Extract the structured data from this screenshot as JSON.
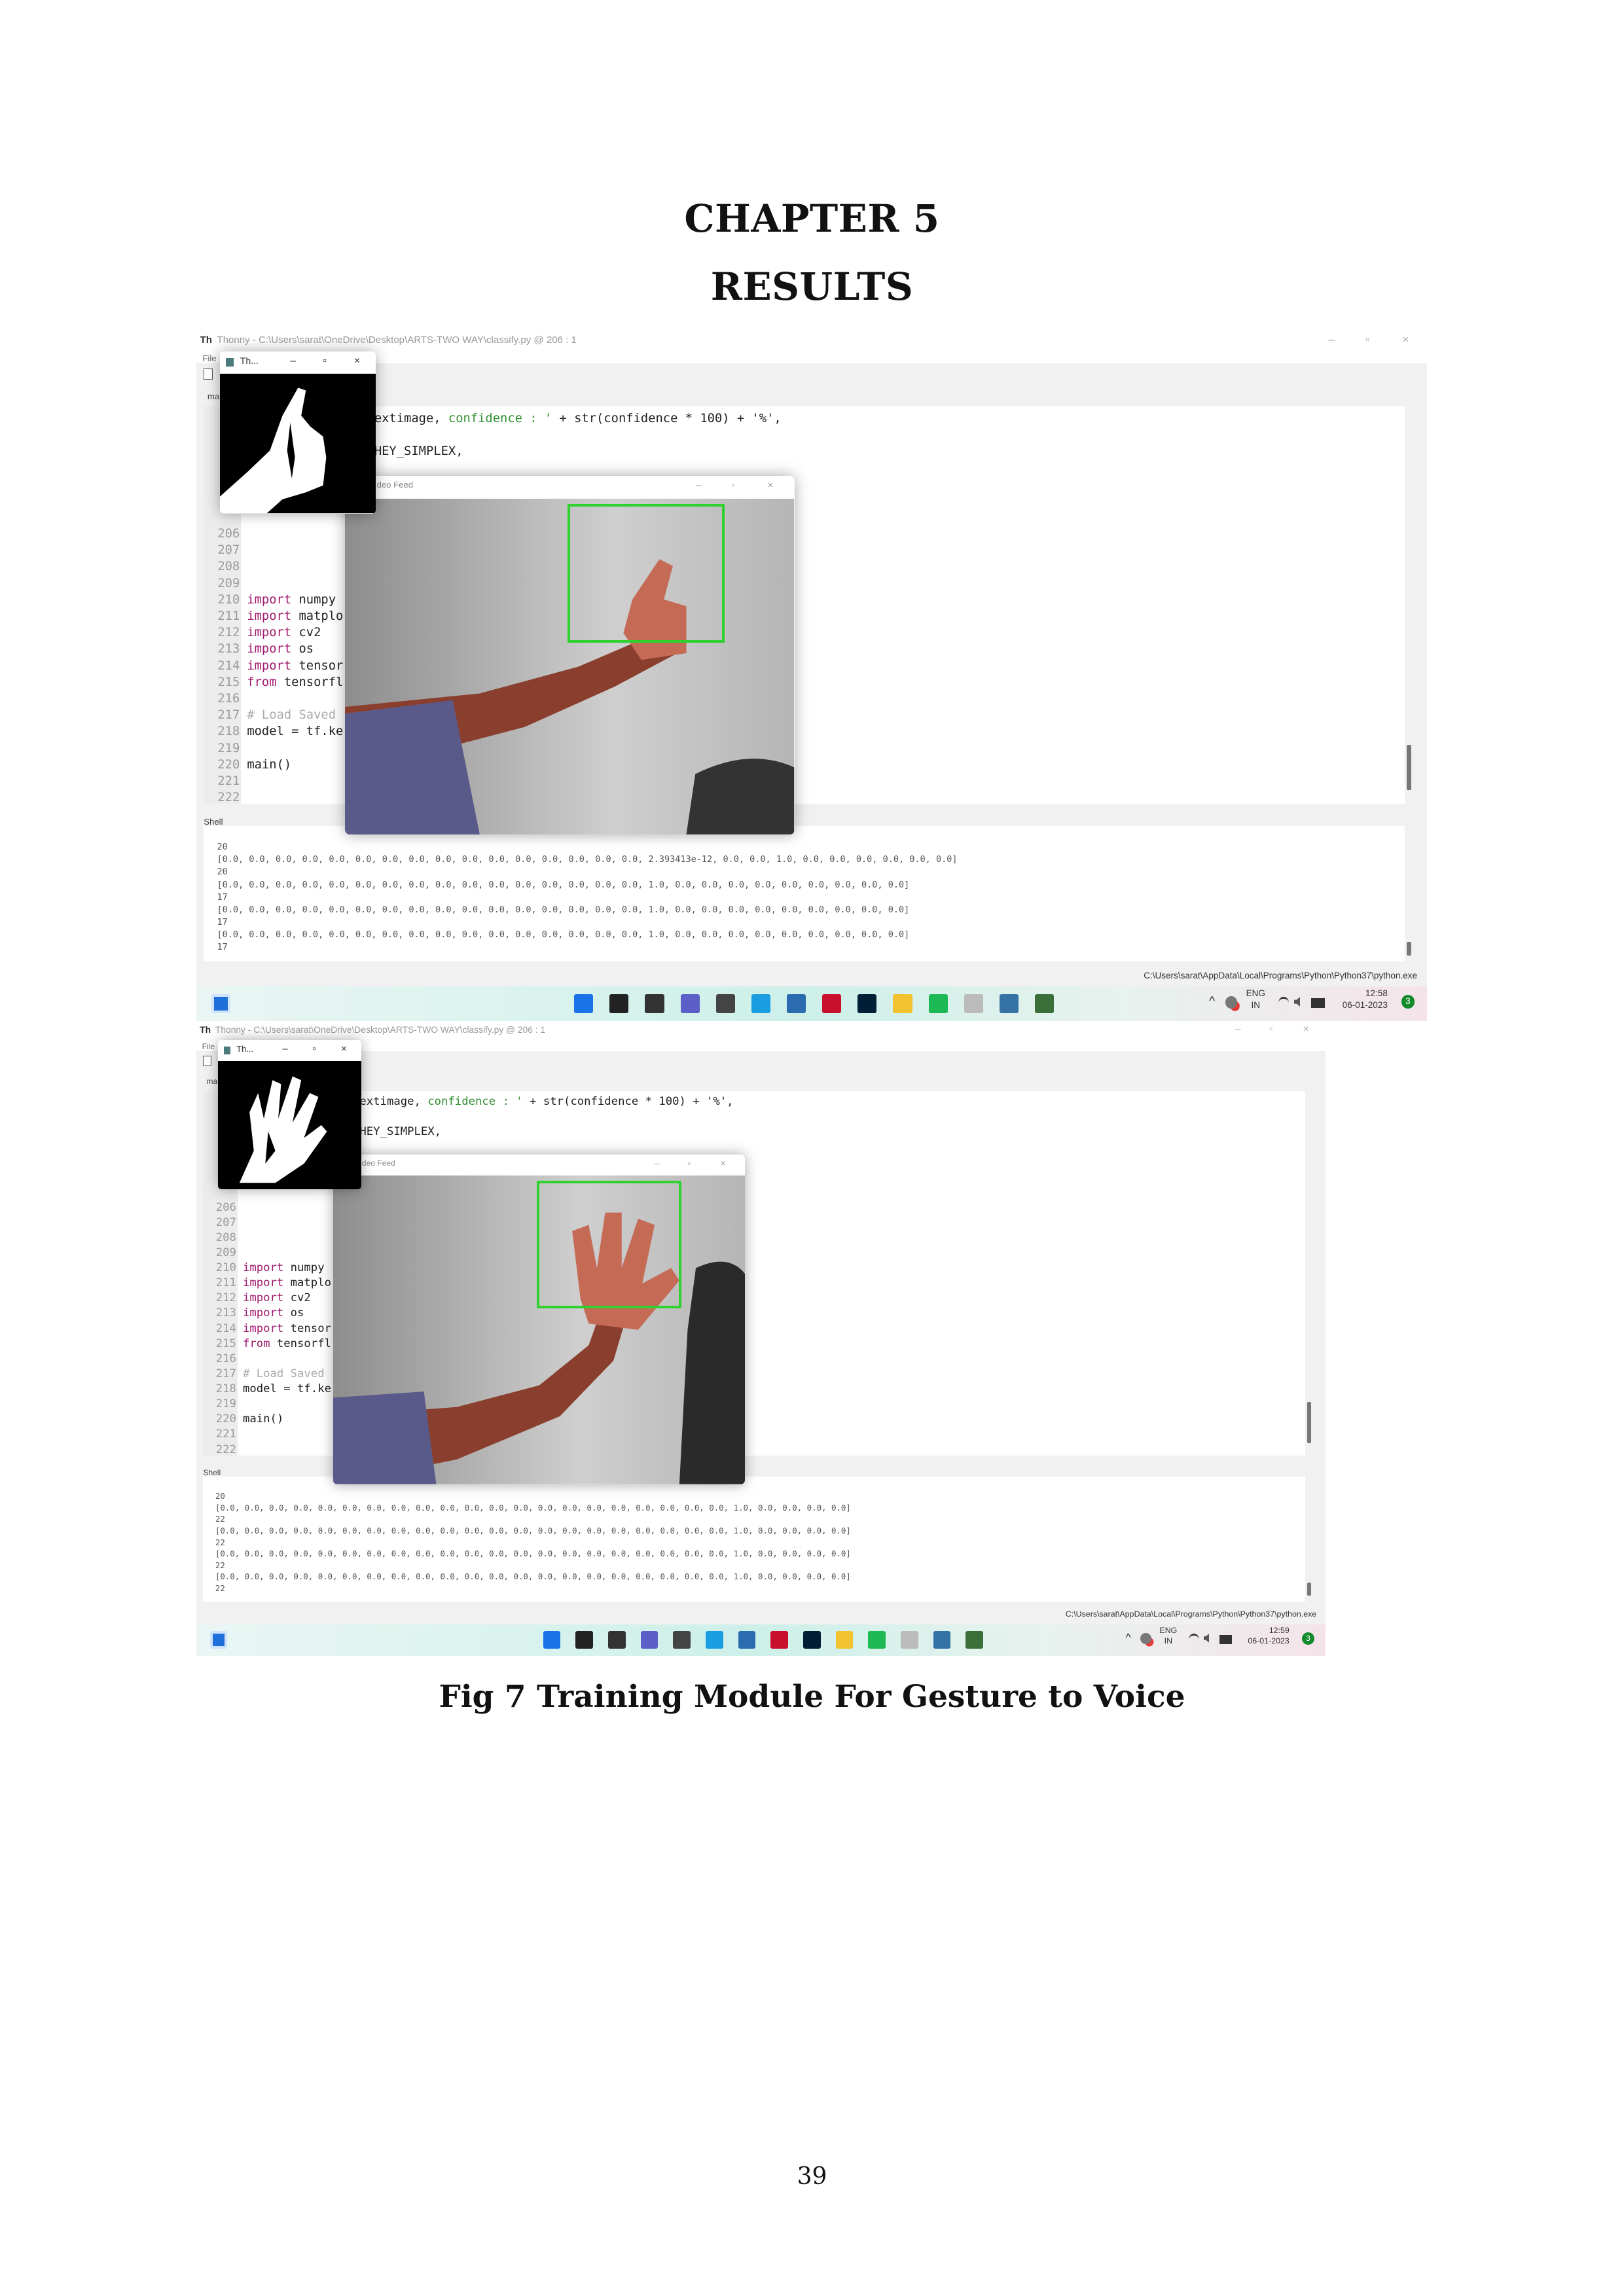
{
  "page": {
    "chapter": "CHAPTER 5",
    "title": "RESULTS",
    "caption": "Fig 7 Training Module For Gesture to Voice",
    "page_number": "39"
  },
  "screenshots": [
    {
      "app_name": "Thonny",
      "window_title": "Thonny - C:\\Users\\sarat\\OneDrive\\Desktop\\ARTS-TWO WAY\\classify.py @ 206 : 1",
      "menu_file": "File",
      "editor_tab": "ma",
      "threshold_window_title": "Th...",
      "video_window_title": "deo Feed",
      "code_fragment_1a": "extimage, ",
      "code_fragment_1b": "confidence : '",
      "code_fragment_1c": " + str(confidence * 100) + '%',",
      "code_fragment_2": "HEY_SIMPLEX,",
      "lines": [
        {
          "n": "206",
          "kw": "",
          "rest": ""
        },
        {
          "n": "207",
          "kw": "",
          "rest": ""
        },
        {
          "n": "208",
          "kw": "",
          "rest": ""
        },
        {
          "n": "209",
          "kw": "",
          "rest": ""
        },
        {
          "n": "210",
          "kw": "import",
          "rest": " numpy"
        },
        {
          "n": "211",
          "kw": "import",
          "rest": " matplo"
        },
        {
          "n": "212",
          "kw": "import",
          "rest": " cv2"
        },
        {
          "n": "213",
          "kw": "import",
          "rest": " os"
        },
        {
          "n": "214",
          "kw": "import",
          "rest": " tensor"
        },
        {
          "n": "215",
          "kw": "from",
          "rest": " tensorfl"
        },
        {
          "n": "216",
          "kw": "",
          "rest": ""
        },
        {
          "n": "217",
          "kw": "",
          "rest": "",
          "comment": "# Load Saved"
        },
        {
          "n": "218",
          "kw": "",
          "rest": "model = tf.ke"
        },
        {
          "n": "219",
          "kw": "",
          "rest": ""
        },
        {
          "n": "220",
          "kw": "",
          "rest": "main()"
        },
        {
          "n": "221",
          "kw": "",
          "rest": ""
        },
        {
          "n": "222",
          "kw": "",
          "rest": ""
        }
      ],
      "shell_label": "Shell",
      "shell_lines": [
        "20",
        "[0.0, 0.0, 0.0, 0.0, 0.0, 0.0, 0.0, 0.0, 0.0, 0.0, 0.0, 0.0, 0.0, 0.0, 0.0, 0.0, 2.393413e-12, 0.0, 0.0, 1.0, 0.0, 0.0, 0.0, 0.0, 0.0, 0.0]",
        "20",
        "[0.0, 0.0, 0.0, 0.0, 0.0, 0.0, 0.0, 0.0, 0.0, 0.0, 0.0, 0.0, 0.0, 0.0, 0.0, 0.0, 1.0, 0.0, 0.0, 0.0, 0.0, 0.0, 0.0, 0.0, 0.0, 0.0]",
        "17",
        "[0.0, 0.0, 0.0, 0.0, 0.0, 0.0, 0.0, 0.0, 0.0, 0.0, 0.0, 0.0, 0.0, 0.0, 0.0, 0.0, 1.0, 0.0, 0.0, 0.0, 0.0, 0.0, 0.0, 0.0, 0.0, 0.0]",
        "17",
        "[0.0, 0.0, 0.0, 0.0, 0.0, 0.0, 0.0, 0.0, 0.0, 0.0, 0.0, 0.0, 0.0, 0.0, 0.0, 0.0, 1.0, 0.0, 0.0, 0.0, 0.0, 0.0, 0.0, 0.0, 0.0, 0.0]",
        "17"
      ],
      "interpreter_path": "C:\\Users\\sarat\\AppData\\Local\\Programs\\Python\\Python37\\python.exe",
      "tray": {
        "lang": "ENG",
        "region": "IN",
        "time": "12:58",
        "date": "06-01-2023",
        "badge": "3"
      },
      "gesture": "thumbs-up"
    },
    {
      "app_name": "Thonny",
      "window_title": "Thonny - C:\\Users\\sarat\\OneDrive\\Desktop\\ARTS-TWO WAY\\classify.py @ 206 : 1",
      "menu_file": "File",
      "editor_tab": "ma",
      "threshold_window_title": "Th...",
      "video_window_title": "deo Feed",
      "code_fragment_1a": "extimage, ",
      "code_fragment_1b": "confidence : '",
      "code_fragment_1c": " + str(confidence * 100) + '%',",
      "code_fragment_2": "HEY_SIMPLEX,",
      "lines": [
        {
          "n": "206",
          "kw": "",
          "rest": ""
        },
        {
          "n": "207",
          "kw": "",
          "rest": ""
        },
        {
          "n": "208",
          "kw": "",
          "rest": ""
        },
        {
          "n": "209",
          "kw": "",
          "rest": ""
        },
        {
          "n": "210",
          "kw": "import",
          "rest": " numpy"
        },
        {
          "n": "211",
          "kw": "import",
          "rest": " matplo"
        },
        {
          "n": "212",
          "kw": "import",
          "rest": " cv2"
        },
        {
          "n": "213",
          "kw": "import",
          "rest": " os"
        },
        {
          "n": "214",
          "kw": "import",
          "rest": " tensor"
        },
        {
          "n": "215",
          "kw": "from",
          "rest": " tensorfl"
        },
        {
          "n": "216",
          "kw": "",
          "rest": ""
        },
        {
          "n": "217",
          "kw": "",
          "rest": "",
          "comment": "# Load Saved"
        },
        {
          "n": "218",
          "kw": "",
          "rest": "model = tf.ke"
        },
        {
          "n": "219",
          "kw": "",
          "rest": ""
        },
        {
          "n": "220",
          "kw": "",
          "rest": "main()"
        },
        {
          "n": "221",
          "kw": "",
          "rest": ""
        },
        {
          "n": "222",
          "kw": "",
          "rest": ""
        }
      ],
      "shell_label": "Shell",
      "shell_lines": [
        "20",
        "[0.0, 0.0, 0.0, 0.0, 0.0, 0.0, 0.0, 0.0, 0.0, 0.0, 0.0, 0.0, 0.0, 0.0, 0.0, 0.0, 0.0, 0.0, 0.0, 0.0, 0.0, 1.0, 0.0, 0.0, 0.0, 0.0]",
        "22",
        "[0.0, 0.0, 0.0, 0.0, 0.0, 0.0, 0.0, 0.0, 0.0, 0.0, 0.0, 0.0, 0.0, 0.0, 0.0, 0.0, 0.0, 0.0, 0.0, 0.0, 0.0, 1.0, 0.0, 0.0, 0.0, 0.0]",
        "22",
        "[0.0, 0.0, 0.0, 0.0, 0.0, 0.0, 0.0, 0.0, 0.0, 0.0, 0.0, 0.0, 0.0, 0.0, 0.0, 0.0, 0.0, 0.0, 0.0, 0.0, 0.0, 1.0, 0.0, 0.0, 0.0, 0.0]",
        "22",
        "[0.0, 0.0, 0.0, 0.0, 0.0, 0.0, 0.0, 0.0, 0.0, 0.0, 0.0, 0.0, 0.0, 0.0, 0.0, 0.0, 0.0, 0.0, 0.0, 0.0, 0.0, 1.0, 0.0, 0.0, 0.0, 0.0]",
        "22"
      ],
      "interpreter_path": "C:\\Users\\sarat\\AppData\\Local\\Programs\\Python\\Python37\\python.exe",
      "tray": {
        "lang": "ENG",
        "region": "IN",
        "time": "12:59",
        "date": "06-01-2023",
        "badge": "3"
      },
      "gesture": "open-palm"
    }
  ],
  "taskbar_icons": [
    {
      "name": "windows-start-icon",
      "color": "#1a73e8"
    },
    {
      "name": "search-icon",
      "color": "#222222"
    },
    {
      "name": "task-view-icon",
      "color": "#333333"
    },
    {
      "name": "teams-chat-icon",
      "color": "#5b5fc7"
    },
    {
      "name": "dell-icon",
      "color": "#444444"
    },
    {
      "name": "edge-icon",
      "color": "#1b9de2"
    },
    {
      "name": "store-icon",
      "color": "#2b6cb0"
    },
    {
      "name": "mcafee-icon",
      "color": "#c8102e"
    },
    {
      "name": "photoshop-icon",
      "color": "#001e36"
    },
    {
      "name": "file-explorer-icon",
      "color": "#f2c230"
    },
    {
      "name": "spotify-icon",
      "color": "#1db954"
    },
    {
      "name": "thonny-icon",
      "color": "#bbbbbb"
    },
    {
      "name": "python-icon",
      "color": "#3572a5"
    },
    {
      "name": "app-icon",
      "color": "#3a6f3a"
    }
  ],
  "colors": {
    "detection_box": "#2fd12f",
    "keyword": "#a01a6e"
  }
}
